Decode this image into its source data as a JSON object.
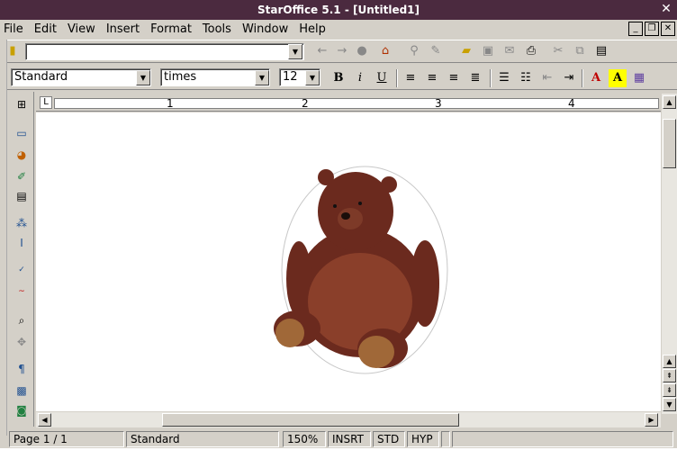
{
  "window": {
    "title": "StarOffice 5.1 - [Untitled1]"
  },
  "menu": [
    "File",
    "Edit",
    "View",
    "Insert",
    "Format",
    "Tools",
    "Window",
    "Help"
  ],
  "url_field": {
    "value": ""
  },
  "format_toolbar": {
    "style": "Standard",
    "font": "times",
    "size": "12",
    "bold_label": "B",
    "italic_label": "i",
    "underline_label": "U"
  },
  "ruler": {
    "marks": [
      "1",
      "2",
      "3",
      "4"
    ]
  },
  "status": {
    "page": "Page 1 / 1",
    "style": "Standard",
    "zoom": "150%",
    "insert_mode": "INSRT",
    "selection_mode": "STD",
    "hyphenation": "HYP"
  },
  "document": {
    "image": "teddy-bear"
  }
}
